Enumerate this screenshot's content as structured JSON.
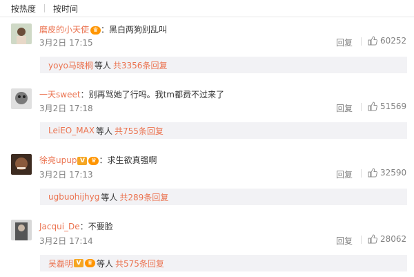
{
  "tabs": {
    "hot": "按热度",
    "time": "按时间"
  },
  "comments": [
    {
      "user": "磨皮的小天使",
      "text": "黑白两狗别乱叫",
      "date": "3月2日 17:15",
      "reply_label": "回复",
      "likes": "60252",
      "sub": {
        "user": "yoyo马晓桐",
        "mid": "等人",
        "count": "共3356条回复"
      },
      "avatar_color": "#b9c7b0"
    },
    {
      "user": "一天sweet",
      "text": "别再骂她了行吗。我tm都费不过来了",
      "date": "3月2日 17:18",
      "reply_label": "回复",
      "likes": "51569",
      "sub": {
        "user": "LeiEO_MAX",
        "mid": "等人",
        "count": "共755条回复"
      },
      "avatar_color": "#8a8a8a"
    },
    {
      "user": "徐亮upup",
      "text": "求生欲真强啊",
      "date": "3月2日 17:13",
      "reply_label": "回复",
      "likes": "32590",
      "sub": {
        "user": "ugbuohijhyg",
        "mid": "等人",
        "count": "共289条回复"
      },
      "avatar_color": "#5a4030"
    },
    {
      "user": "Jacqui_De",
      "text": "不要脸",
      "date": "3月2日 17:14",
      "reply_label": "回复",
      "likes": "28062",
      "sub": {
        "user": "吴磊明",
        "mid": "等人",
        "count": "共575条回复"
      },
      "avatar_color": "#6e6e6e"
    }
  ],
  "icons": {
    "like": "thumbs-up-icon",
    "vip": "v-verified-icon",
    "crown": "crown-badge-icon"
  },
  "colors": {
    "link": "#eb7350",
    "meta": "#808080",
    "subbox_bg": "#f2f2f5"
  }
}
